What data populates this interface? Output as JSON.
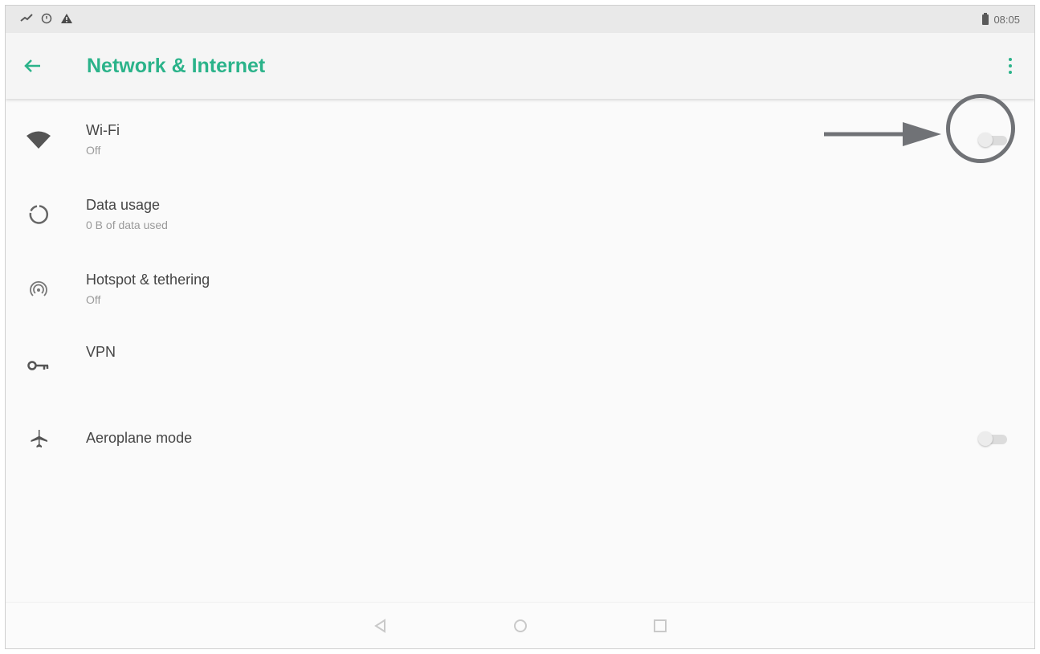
{
  "status_bar": {
    "time": "08:05",
    "left_icons": [
      "data-saver-icon",
      "alarm-icon",
      "warning-icon"
    ],
    "battery_icon": "battery-icon"
  },
  "app_bar": {
    "title": "Network & Internet",
    "back_icon": "back-arrow-icon",
    "menu_icon": "overflow-menu-icon",
    "accent_color": "#2bb38a"
  },
  "items": [
    {
      "title": "Wi-Fi",
      "subtitle": "Off",
      "icon": "wifi-icon",
      "toggle": "off"
    },
    {
      "title": "Data usage",
      "subtitle": "0 B of data used",
      "icon": "data-usage-icon"
    },
    {
      "title": "Hotspot & tethering",
      "subtitle": "Off",
      "icon": "hotspot-icon"
    },
    {
      "title": "VPN",
      "subtitle": "",
      "icon": "vpn-key-icon"
    },
    {
      "title": "Aeroplane mode",
      "subtitle": "",
      "icon": "airplane-icon",
      "toggle": "off"
    }
  ],
  "nav_bar": {
    "buttons": [
      "back-nav-icon",
      "home-nav-icon",
      "recents-nav-icon"
    ]
  },
  "annotation": {
    "color": "#707276",
    "target": "wifi-toggle"
  }
}
